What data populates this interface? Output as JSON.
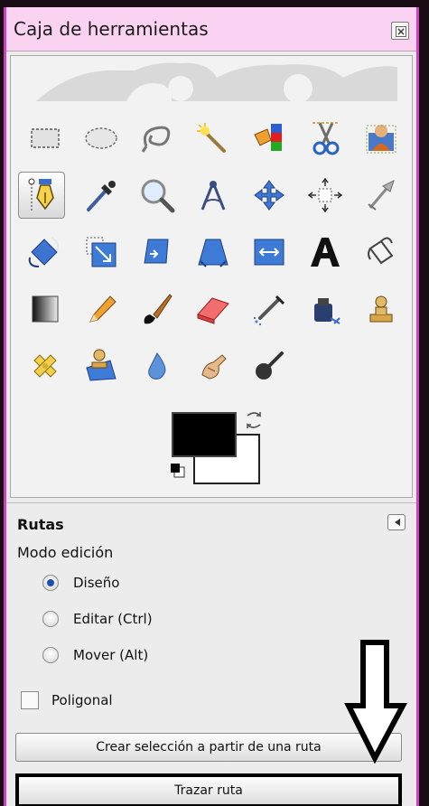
{
  "window": {
    "title": "Caja de herramientas",
    "close_icon": "close-icon"
  },
  "toolbox": {
    "tools": [
      "rect-select-icon",
      "ellipse-select-icon",
      "free-select-icon",
      "fuzzy-select-icon",
      "color-select-icon",
      "scissors-select-icon",
      "foreground-select-icon",
      "paths-icon",
      "color-picker-icon",
      "zoom-icon",
      "measure-icon",
      "move-icon",
      "align-icon",
      "crop-icon",
      "rotate-icon",
      "scale-icon",
      "shear-icon",
      "perspective-icon",
      "flip-icon",
      "text-icon",
      "bucket-fill-icon",
      "blend-icon",
      "pencil-icon",
      "paintbrush-icon",
      "eraser-icon",
      "airbrush-icon",
      "ink-icon",
      "clone-icon",
      "heal-icon",
      "perspective-clone-icon",
      "blur-icon",
      "smudge-icon",
      "dodge-burn-icon"
    ],
    "active_tool": "paths-icon",
    "foreground_color": "#000000",
    "background_color": "#ffffff"
  },
  "options": {
    "title": "Rutas",
    "mode_label": "Modo edición",
    "modes": [
      {
        "label": "Diseño",
        "checked": true
      },
      {
        "label": "Editar (Ctrl)",
        "checked": false
      },
      {
        "label": "Mover (Alt)",
        "checked": false
      }
    ],
    "polygonal_label": "Poligonal",
    "polygonal_checked": false,
    "create_selection_button": "Crear selección a partir de una ruta",
    "stroke_path_button": "Trazar ruta"
  },
  "annotation": {
    "arrow_icon": "down-arrow-icon"
  }
}
